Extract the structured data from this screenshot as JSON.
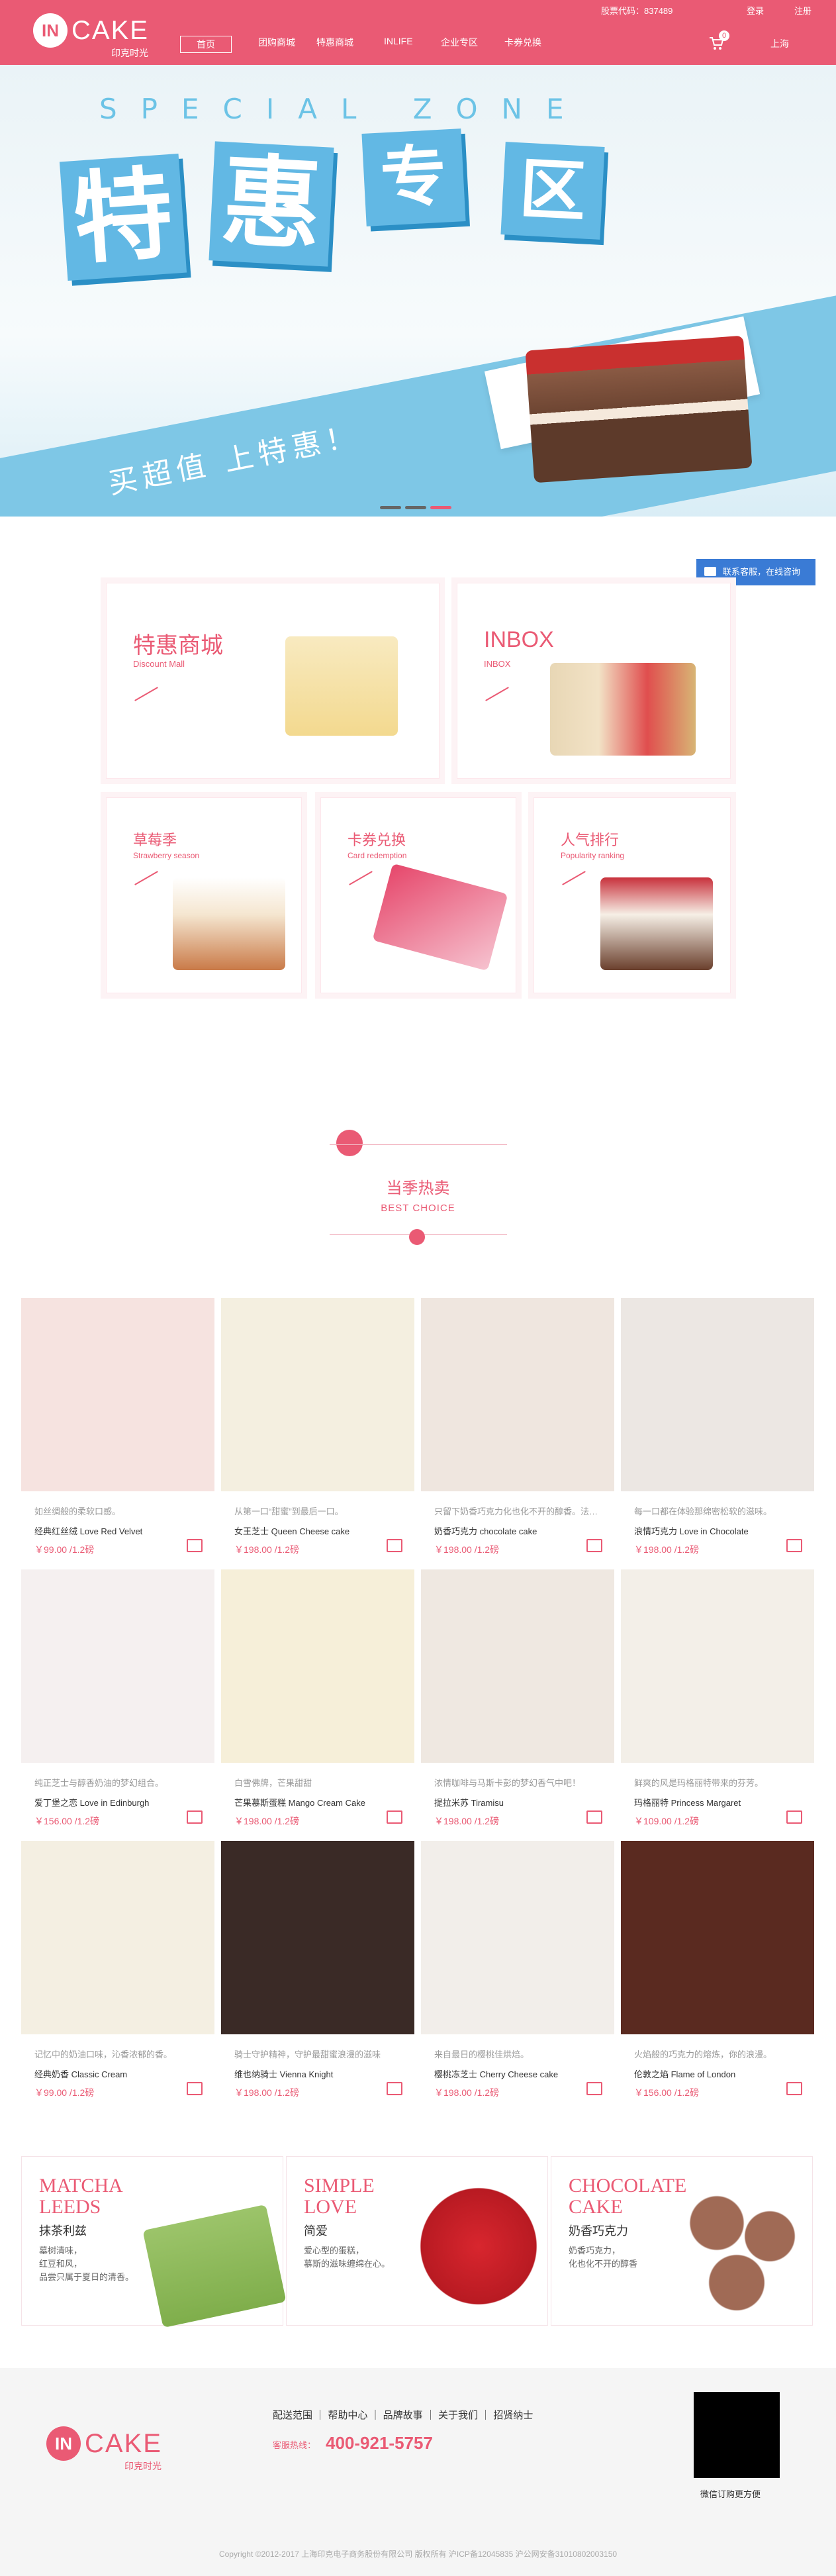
{
  "header": {
    "logo_in": "IN",
    "logo_cake": "CAKE",
    "logo_sub": "印克时光",
    "stock": "股票代码：837489",
    "login": "登录",
    "register": "注册",
    "nav": [
      "首页",
      "团购商城",
      "特惠商城",
      "INLIFE",
      "企业专区",
      "卡券兑换"
    ],
    "cart_count": "0",
    "city": "上海"
  },
  "hero": {
    "zone": "SPECIAL ZONE",
    "t1": "特",
    "t2": "惠",
    "t3": "专",
    "t4": "区",
    "slogan": "买超值 上特惠！",
    "accent": "#62b8e4"
  },
  "promos": [
    {
      "title": "特惠商城",
      "en": "Discount Mall"
    },
    {
      "title": "INBOX",
      "en": "INBOX"
    },
    {
      "title": "草莓季",
      "en": "Strawberry season"
    },
    {
      "title": "卡券兑换",
      "en": "Card redemption"
    },
    {
      "title": "人气排行",
      "en": "Popularity ranking"
    }
  ],
  "chat": "联系客服，在线咨询",
  "section": {
    "title": "当季热卖",
    "subtitle": "BEST CHOICE"
  },
  "products": [
    {
      "desc": "如丝绸般的柔软口感。",
      "name": "经典红丝绒 Love Red Velvet",
      "price": "￥99.00 /1.2磅"
    },
    {
      "desc": "从第一口“甜蜜”到最后一口。",
      "name": "女王芝士 Queen Cheese cake",
      "price": "￥198.00 /1.2磅"
    },
    {
      "desc": "只留下奶香巧克力化也化不开的醇香。法…",
      "name": "奶香巧克力 chocolate cake",
      "price": "￥198.00 /1.2磅"
    },
    {
      "desc": "每一口都在体验那绵密松软的滋味。",
      "name": "浪情巧克力 Love in Chocolate",
      "price": "￥198.00 /1.2磅"
    },
    {
      "desc": "纯正芝士与醇香奶油的梦幻组合。",
      "name": "爱丁堡之恋 Love in Edinburgh",
      "price": "￥156.00 /1.2磅"
    },
    {
      "desc": "白雪佛牌，芒果甜甜",
      "name": "芒果慕斯蛋糕 Mango Cream Cake",
      "price": "￥198.00 /1.2磅"
    },
    {
      "desc": "浓情咖啡与马斯卡彭的梦幻香气中吧！",
      "name": "提拉米苏 Tiramisu",
      "price": "￥198.00 /1.2磅"
    },
    {
      "desc": "鲜爽的风是玛格丽特带来的芬芳。",
      "name": "玛格丽特 Princess Margaret",
      "price": "￥109.00 /1.2磅"
    },
    {
      "desc": "记忆中的奶油口味，沁香浓郁的香。",
      "name": "经典奶香 Classic Cream",
      "price": "￥99.00 /1.2磅"
    },
    {
      "desc": "骑士守护精神，守护最甜蜜浪漫的滋味",
      "name": "维也纳骑士 Vienna Knight",
      "price": "￥198.00 /1.2磅"
    },
    {
      "desc": "来自最日的樱桃佳烘焙。",
      "name": "樱桃冻芝士 Cherry Cheese cake",
      "price": "￥198.00 /1.2磅"
    },
    {
      "desc": "火焰般的巧克力的熔炼，你的浪漫。",
      "name": "伦敦之焰 Flame of London",
      "price": "￥156.00 /1.2磅"
    }
  ],
  "features": [
    {
      "en1": "MATCHA",
      "en2": "LEEDS",
      "cn": "抹茶利兹",
      "d1": "墓树清味，",
      "d2": "红豆和风，",
      "d3": "品尝只属于夏日的清香。"
    },
    {
      "en1": "SIMPLE",
      "en2": "LOVE",
      "cn": "简爱",
      "d1": "爱心型的蛋糕，",
      "d2": "慕斯的滋味缠绵在心。"
    },
    {
      "en1": "CHOCOLATE",
      "en2": "CAKE",
      "cn": "奶香巧克力",
      "d1": "奶香巧克力，",
      "d2": "化也化不开的醇香"
    }
  ],
  "footer": {
    "links": "配送范围 ｜ 帮助中心 ｜ 品牌故事 ｜ 关于我们 ｜ 招贤纳士",
    "hot": "客服热线：",
    "tel": "400-921-5757",
    "qr": "微信订购更方便",
    "copy": "Copyright ©2012-2017 上海印克电子商务股份有限公司 版权所有 沪ICP备12045835 沪公网安备31010802003150"
  }
}
